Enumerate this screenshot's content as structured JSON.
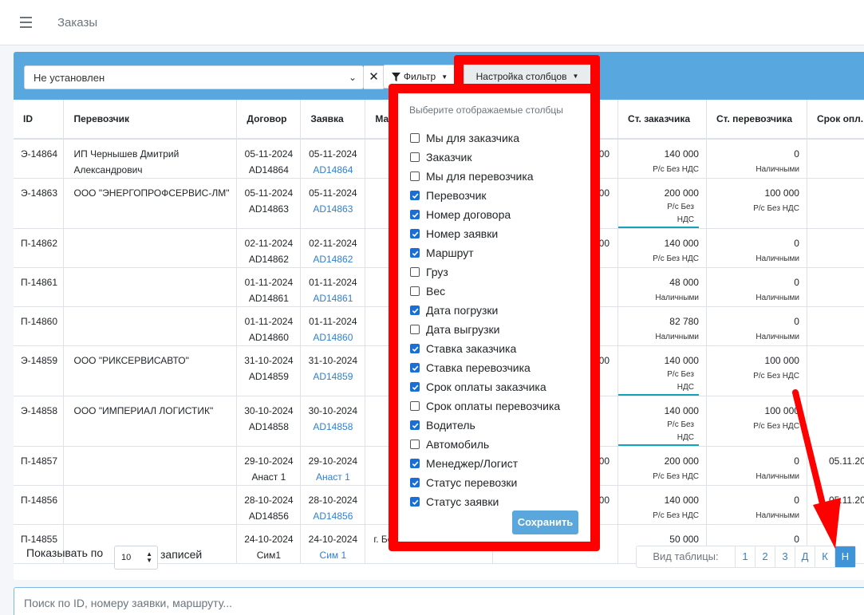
{
  "header": {
    "title": "Заказы"
  },
  "toolbar": {
    "select_value": "Не установлен",
    "clear_label": "✕",
    "filter_label": "Фильтр",
    "columns_label": "Настройка столбцов"
  },
  "columns_dropdown": {
    "hint": "Выберите отображаемые столбцы",
    "save_label": "Сохранить",
    "items": [
      {
        "label": "Мы для заказчика",
        "checked": false
      },
      {
        "label": "Заказчик",
        "checked": false
      },
      {
        "label": "Мы для перевозчика",
        "checked": false
      },
      {
        "label": "Перевозчик",
        "checked": true
      },
      {
        "label": "Номер договора",
        "checked": true
      },
      {
        "label": "Номер заявки",
        "checked": true
      },
      {
        "label": "Маршрут",
        "checked": true
      },
      {
        "label": "Груз",
        "checked": false
      },
      {
        "label": "Вес",
        "checked": false
      },
      {
        "label": "Дата погрузки",
        "checked": true
      },
      {
        "label": "Дата выгрузки",
        "checked": false
      },
      {
        "label": "Ставка заказчика",
        "checked": true
      },
      {
        "label": "Ставка перевозчика",
        "checked": true
      },
      {
        "label": "Срок оплаты заказчика",
        "checked": true
      },
      {
        "label": "Срок оплаты перевозчика",
        "checked": false
      },
      {
        "label": "Водитель",
        "checked": true
      },
      {
        "label": "Автомобиль",
        "checked": false
      },
      {
        "label": "Менеджер/Логист",
        "checked": true
      },
      {
        "label": "Статус перевозки",
        "checked": true
      },
      {
        "label": "Статус заявки",
        "checked": true
      }
    ]
  },
  "table": {
    "headers": [
      "ID",
      "Перевозчик",
      "Договор",
      "Заявка",
      "Ма",
      "",
      "Ст. заказчика",
      "Ст. перевозчика",
      "Срок опл."
    ],
    "rows": [
      {
        "id": "Э-14864",
        "carrier": "ИП Чернышев Дмитрий Александрович",
        "contract_date": "05-11-2024",
        "contract_no": "AD14864",
        "req_date": "05-11-2024",
        "req_no": "AD14864",
        "route": "",
        "load": "00",
        "cust_amount": "140 000",
        "cust_pay": "Р/с Без НДС",
        "cust_ul": false,
        "carr_amount": "0",
        "carr_pay": "Наличными",
        "due": ""
      },
      {
        "id": "Э-14863",
        "carrier": "ООО \"ЭНЕРГОПРОФСЕРВИС-ЛМ\"",
        "contract_date": "05-11-2024",
        "contract_no": "AD14863",
        "req_date": "05-11-2024",
        "req_no": "AD14863",
        "route": "",
        "load": "00",
        "cust_amount": "200 000",
        "cust_pay": "Р/с Без НДС",
        "cust_ul": true,
        "carr_amount": "100 000",
        "carr_pay": "Р/с Без НДС",
        "due": ""
      },
      {
        "id": "П-14862",
        "carrier": "",
        "contract_date": "02-11-2024",
        "contract_no": "AD14862",
        "req_date": "02-11-2024",
        "req_no": "AD14862",
        "route": "",
        "load": "00",
        "cust_amount": "140 000",
        "cust_pay": "Р/с Без НДС",
        "cust_ul": false,
        "carr_amount": "0",
        "carr_pay": "Наличными",
        "due": ""
      },
      {
        "id": "П-14861",
        "carrier": "",
        "contract_date": "01-11-2024",
        "contract_no": "AD14861",
        "req_date": "01-11-2024",
        "req_no": "AD14861",
        "route": "",
        "load": "",
        "cust_amount": "48 000",
        "cust_pay": "Наличными",
        "cust_ul": false,
        "carr_amount": "0",
        "carr_pay": "Наличными",
        "due": ""
      },
      {
        "id": "П-14860",
        "carrier": "",
        "contract_date": "01-11-2024",
        "contract_no": "AD14860",
        "req_date": "01-11-2024",
        "req_no": "AD14860",
        "route": "",
        "load": "",
        "cust_amount": "82 780",
        "cust_pay": "Наличными",
        "cust_ul": false,
        "carr_amount": "0",
        "carr_pay": "Наличными",
        "due": ""
      },
      {
        "id": "Э-14859",
        "carrier": "ООО \"РИКСЕРВИСАВТО\"",
        "contract_date": "31-10-2024",
        "contract_no": "AD14859",
        "req_date": "31-10-2024",
        "req_no": "AD14859",
        "route": "",
        "load": "00",
        "cust_amount": "140 000",
        "cust_pay": "Р/с Без НДС",
        "cust_ul": true,
        "carr_amount": "100 000",
        "carr_pay": "Р/с Без НДС",
        "due": ""
      },
      {
        "id": "Э-14858",
        "carrier": "ООО \"ИМПЕРИАЛ ЛОГИСТИК\"",
        "contract_date": "30-10-2024",
        "contract_no": "AD14858",
        "req_date": "30-10-2024",
        "req_no": "AD14858",
        "route": "",
        "load": "",
        "cust_amount": "140 000",
        "cust_pay": "Р/с Без НДС",
        "cust_ul": true,
        "carr_amount": "100 000",
        "carr_pay": "Р/с Без НДС",
        "due": ""
      },
      {
        "id": "П-14857",
        "carrier": "",
        "contract_date": "29-10-2024",
        "contract_no": "Анаст 1",
        "req_date": "29-10-2024",
        "req_no": "Анаст 1",
        "route": "",
        "load": "00",
        "cust_amount": "200 000",
        "cust_pay": "Р/с Без НДС",
        "cust_ul": false,
        "carr_amount": "0",
        "carr_pay": "Наличными",
        "due": "05.11.20"
      },
      {
        "id": "П-14856",
        "carrier": "",
        "contract_date": "28-10-2024",
        "contract_no": "AD14856",
        "req_date": "28-10-2024",
        "req_no": "AD14856",
        "route": "",
        "load": "00",
        "cust_amount": "140 000",
        "cust_pay": "Р/с Без НДС",
        "cust_ul": false,
        "carr_amount": "0",
        "carr_pay": "Наличными",
        "due": "05.11.20"
      },
      {
        "id": "П-14855",
        "carrier": "",
        "contract_date": "24-10-2024",
        "contract_no": "Сим1",
        "req_date": "24-10-2024",
        "req_no": "Сим 1",
        "route": "г. Бе",
        "load": "",
        "cust_amount": "50 000",
        "cust_pay": "Р/с Без НДС",
        "cust_ul": false,
        "carr_amount": "0",
        "carr_pay": "Наличными",
        "due": ""
      }
    ]
  },
  "footer": {
    "show_prefix": "Показывать по",
    "per_page": "10",
    "show_suffix": "записей",
    "view_label": "Вид таблицы:",
    "views": [
      "1",
      "2",
      "3",
      "Д",
      "К",
      "Н"
    ],
    "active_view": "Н"
  },
  "search": {
    "placeholder": "Поиск по ID, номеру заявки, маршруту..."
  },
  "colors": {
    "accent": "#58a7de",
    "link": "#2f80d1",
    "highlight": "#ff0000",
    "checkbox": "#1a6fd6"
  }
}
